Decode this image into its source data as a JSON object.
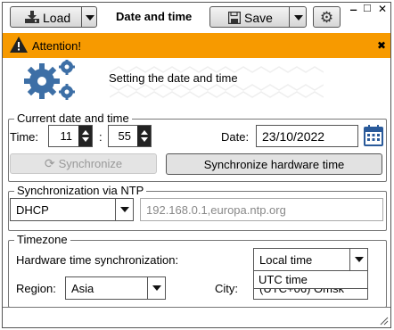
{
  "titlebar": {
    "load_label": "Load",
    "title": "Date and time",
    "save_label": "Save",
    "minimize_glyph": "‒",
    "maximize_glyph": "□",
    "close_glyph": "✕"
  },
  "alert": {
    "text": "Attention!",
    "close_glyph": "✖",
    "color": "#f79a00"
  },
  "header": {
    "text": "Setting the date and time"
  },
  "current": {
    "legend": "Current date and time",
    "time_label": "Time:",
    "hour": "11",
    "separator": ":",
    "minute": "55",
    "date_label": "Date:",
    "date": "23/10/2022",
    "sync_label": "Synchronize",
    "sync_hw_label": "Synchronize hardware time"
  },
  "ntp": {
    "legend": "Synchronization via NTP",
    "mode": "DHCP",
    "servers": "192.168.0.1,europa.ntp.org"
  },
  "timezone": {
    "legend": "Timezone",
    "hw_label": "Hardware time synchronization:",
    "hw_value": "Local time",
    "hw_options": [
      "UTC time"
    ],
    "region_label": "Region:",
    "region_value": "Asia",
    "city_label": "City:",
    "city_value": "(UTC+06) Omsk"
  },
  "colors": {
    "accent_blue": "#3d6fa6",
    "calendar_blue": "#2a5a9a"
  }
}
